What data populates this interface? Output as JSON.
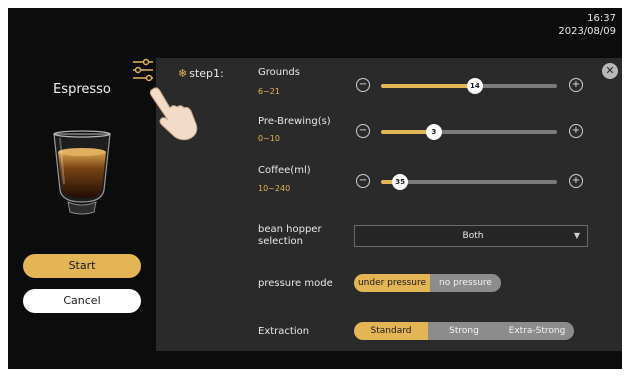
{
  "clock": {
    "time": "16:37",
    "date": "2023/08/09"
  },
  "drink": {
    "name": "Espresso"
  },
  "buttons": {
    "start": "Start",
    "cancel": "Cancel"
  },
  "panel": {
    "step": "step1:",
    "params": [
      {
        "name": "Grounds",
        "range": "6~21",
        "min": 6,
        "max": 21,
        "value": 14,
        "value_label": "14"
      },
      {
        "name": "Pre-Brewing(s)",
        "range": "0~10",
        "min": 0,
        "max": 10,
        "value": 3,
        "value_label": "3"
      },
      {
        "name": "Coffee(ml)",
        "range": "10~240",
        "min": 10,
        "max": 240,
        "value": 35,
        "value_label": "35"
      }
    ],
    "hopper": {
      "label": "bean hopper selection",
      "value": "Both"
    },
    "pressure": {
      "label": "pressure mode",
      "options": [
        "under pressure",
        "no pressure"
      ],
      "selected": 0
    },
    "extraction": {
      "label": "Extraction",
      "options": [
        "Standard",
        "Strong",
        "Extra-Strong"
      ],
      "selected": 0
    }
  },
  "colors": {
    "accent": "#e3b554",
    "panel": "#2a2a2a",
    "background": "#0c0c0c"
  },
  "icons": [
    "settings-sliders-icon",
    "hand-pointer-icon",
    "close-icon",
    "snowflake-icon",
    "minus-icon",
    "plus-icon",
    "dropdown-arrow-icon"
  ]
}
